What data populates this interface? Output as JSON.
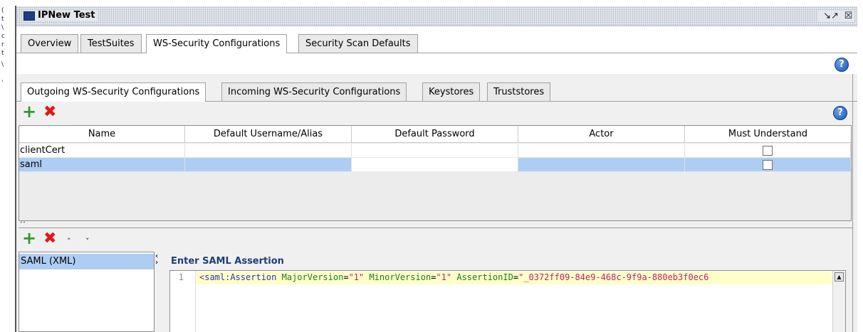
{
  "window": {
    "title": "IPNew Test",
    "buttons": {
      "undock": "↘↗",
      "close": "☒"
    }
  },
  "main_tabs": [
    {
      "label": "Overview",
      "active": false
    },
    {
      "label": "TestSuites",
      "active": false
    },
    {
      "label": "WS-Security Configurations",
      "active": true
    },
    {
      "label": "Security Scan Defaults",
      "active": false
    }
  ],
  "sub_tabs": [
    {
      "label": "Outgoing WS-Security Configurations",
      "active": true
    },
    {
      "label": "Incoming WS-Security Configurations",
      "active": false
    },
    {
      "label": "Keystores",
      "active": false
    },
    {
      "label": "Truststores",
      "active": false
    }
  ],
  "help_icon": {
    "glyph": "?"
  },
  "toolbar": {
    "add": "+",
    "remove": "✖",
    "up": "˄",
    "down": "˅"
  },
  "table": {
    "columns": [
      "Name",
      "Default Username/Alias",
      "Default Password",
      "Actor",
      "Must Understand"
    ],
    "rows": [
      {
        "name": "clientCert",
        "username": "",
        "password": "",
        "actor": "",
        "must_understand": false,
        "selected": false
      },
      {
        "name": "saml",
        "username": "",
        "password": "",
        "actor": "",
        "must_understand": false,
        "selected": true
      }
    ]
  },
  "splitter": {
    "arrows": "˄˅"
  },
  "entries_list": {
    "items": [
      "SAML (XML)"
    ]
  },
  "collapse": {
    "glyph": "<>"
  },
  "saml": {
    "label": "Enter SAML Assertion",
    "line_number": "1",
    "code": {
      "open": "<",
      "tag": "saml:Assertion",
      "attrs": [
        {
          "name": "MajorVersion",
          "value": "\"1\""
        },
        {
          "name": "MinorVersion",
          "value": "\"1\""
        },
        {
          "name": "AssertionID",
          "value": "\"_0372ff09-84e9-468c-9f9a-880eb3f0ec6"
        }
      ]
    }
  },
  "colors": {
    "selection": "#aecdf3",
    "add_green": "#2b9b2b",
    "remove_red": "#e01818",
    "label_blue": "#1e3f78",
    "editor_highlight": "#ffffc8"
  }
}
